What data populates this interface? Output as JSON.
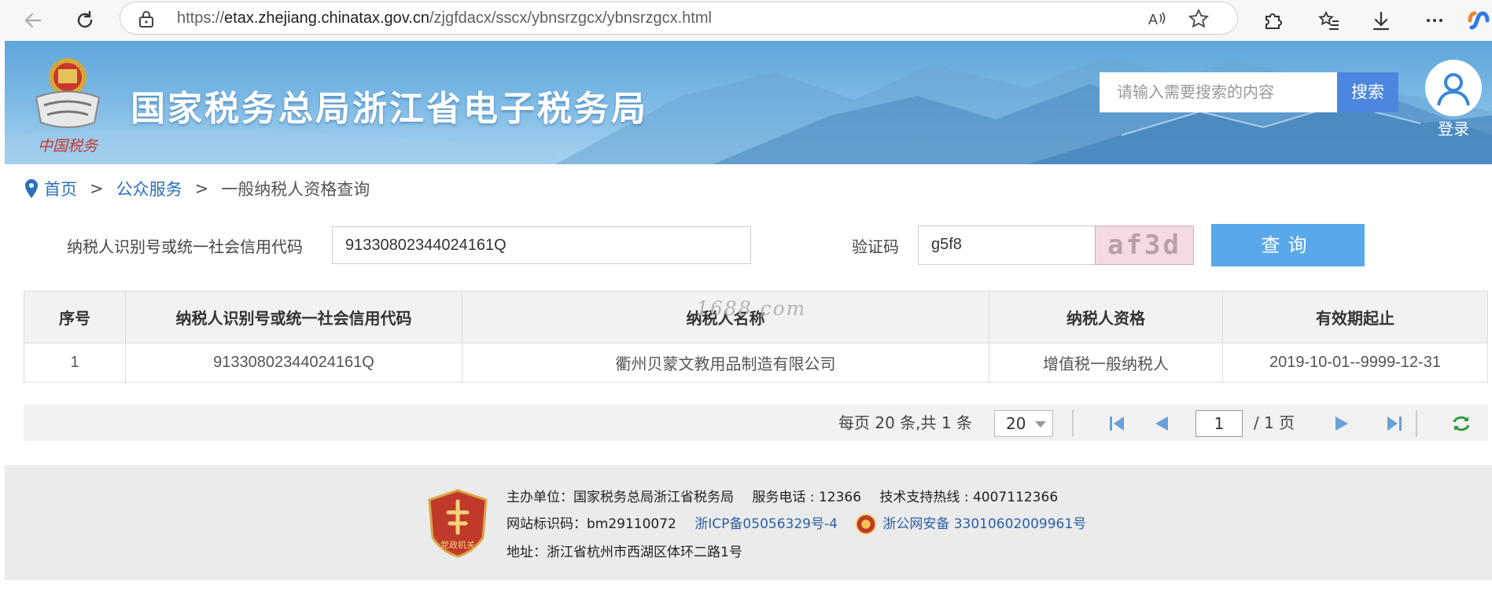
{
  "browser": {
    "url_prefix": "https://",
    "url_host": "etax.zhejiang.chinatax.gov.cn",
    "url_path": "/zjgfdacx/sscx/ybnsrzgcx/ybnsrzgcx.html"
  },
  "header": {
    "site_title": "国家税务总局浙江省电子税务局",
    "emblem_caption": "中国税务",
    "search_placeholder": "请输入需要搜索的内容",
    "search_button": "搜索",
    "login_label": "登录"
  },
  "breadcrumb": {
    "home": "首页",
    "sep": ">",
    "public_service": "公众服务",
    "current": "一般纳税人资格查询"
  },
  "form": {
    "taxid_label": "纳税人识别号或统一社会信用代码",
    "taxid_value": "91330802344024161Q",
    "captcha_label": "验证码",
    "captcha_value": "g5f8",
    "captcha_image_text": "af3d",
    "query_button": "查询"
  },
  "table": {
    "headers": [
      "序号",
      "纳税人识别号或统一社会信用代码",
      "纳税人名称",
      "纳税人资格",
      "有效期起止"
    ],
    "rows": [
      [
        "1",
        "91330802344024161Q",
        "衢州贝蒙文教用品制造有限公司",
        "增值税一般纳税人",
        "2019-10-01--9999-12-31"
      ]
    ],
    "watermark": "1688.com"
  },
  "pager": {
    "info": "每页 20 条,共 1 条",
    "page_size": "20",
    "current_page": "1",
    "total_pages": "/ 1 页"
  },
  "footer": {
    "badge_text": "党政机关",
    "sponsor": "主办单位：国家税务总局浙江省税务局",
    "service_phone": "服务电话 : 12366",
    "support_phone": "技术支持热线 : 4007112366",
    "site_id": "网站标识码：bm29110072",
    "icp": "浙ICP备05056329号-4",
    "police": "浙公网安备 33010602009961号",
    "address": "地址：浙江省杭州市西湖区体环二路1号"
  },
  "colors": {
    "accent_blue": "#4b87e0",
    "query_button": "#58a8ea",
    "link_blue": "#2a6fbf"
  }
}
